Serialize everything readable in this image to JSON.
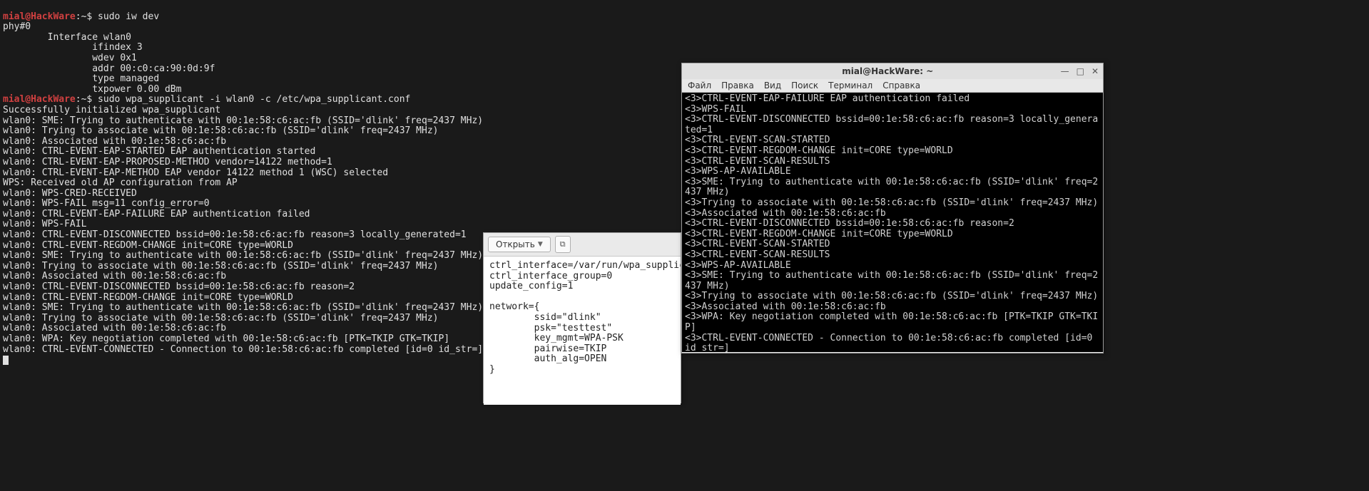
{
  "bg_terminal": {
    "prompt_user": "mial@HackWare",
    "prompt_sep": ":~$",
    "cmd1": " sudo iw dev",
    "out1": "phy#0\n        Interface wlan0\n                ifindex 3\n                wdev 0x1\n                addr 00:c0:ca:90:0d:9f\n                type managed\n                txpower 0.00 dBm",
    "cmd2": " sudo wpa_supplicant -i wlan0 -c /etc/wpa_supplicant.conf",
    "out2": "Successfully initialized wpa_supplicant\nwlan0: SME: Trying to authenticate with 00:1e:58:c6:ac:fb (SSID='dlink' freq=2437 MHz)\nwlan0: Trying to associate with 00:1e:58:c6:ac:fb (SSID='dlink' freq=2437 MHz)\nwlan0: Associated with 00:1e:58:c6:ac:fb\nwlan0: CTRL-EVENT-EAP-STARTED EAP authentication started\nwlan0: CTRL-EVENT-EAP-PROPOSED-METHOD vendor=14122 method=1\nwlan0: CTRL-EVENT-EAP-METHOD EAP vendor 14122 method 1 (WSC) selected\nWPS: Received old AP configuration from AP\nwlan0: WPS-CRED-RECEIVED\nwlan0: WPS-FAIL msg=11 config_error=0\nwlan0: CTRL-EVENT-EAP-FAILURE EAP authentication failed\nwlan0: WPS-FAIL\nwlan0: CTRL-EVENT-DISCONNECTED bssid=00:1e:58:c6:ac:fb reason=3 locally_generated=1\nwlan0: CTRL-EVENT-REGDOM-CHANGE init=CORE type=WORLD\nwlan0: SME: Trying to authenticate with 00:1e:58:c6:ac:fb (SSID='dlink' freq=2437 MHz)\nwlan0: Trying to associate with 00:1e:58:c6:ac:fb (SSID='dlink' freq=2437 MHz)\nwlan0: Associated with 00:1e:58:c6:ac:fb\nwlan0: CTRL-EVENT-DISCONNECTED bssid=00:1e:58:c6:ac:fb reason=2\nwlan0: CTRL-EVENT-REGDOM-CHANGE init=CORE type=WORLD\nwlan0: SME: Trying to authenticate with 00:1e:58:c6:ac:fb (SSID='dlink' freq=2437 MHz)\nwlan0: Trying to associate with 00:1e:58:c6:ac:fb (SSID='dlink' freq=2437 MHz)\nwlan0: Associated with 00:1e:58:c6:ac:fb\nwlan0: WPA: Key negotiation completed with 00:1e:58:c6:ac:fb [PTK=TKIP GTK=TKIP]\nwlan0: CTRL-EVENT-CONNECTED - Connection to 00:1e:58:c6:ac:fb completed [id=0 id_str=]"
  },
  "editor": {
    "open_label": "Открыть",
    "content": "ctrl_interface=/var/run/wpa_supplican\nctrl_interface_group=0\nupdate_config=1\n\nnetwork={\n        ssid=\"dlink\"\n        psk=\"testtest\"\n        key_mgmt=WPA-PSK\n        pairwise=TKIP\n        auth_alg=OPEN\n}"
  },
  "term2": {
    "title": "mial@HackWare: ~",
    "menu": [
      "Файл",
      "Правка",
      "Вид",
      "Поиск",
      "Терминал",
      "Справка"
    ],
    "body": "<3>CTRL-EVENT-EAP-FAILURE EAP authentication failed\n<3>WPS-FAIL\n<3>CTRL-EVENT-DISCONNECTED bssid=00:1e:58:c6:ac:fb reason=3 locally_generated=1\n<3>CTRL-EVENT-SCAN-STARTED\n<3>CTRL-EVENT-REGDOM-CHANGE init=CORE type=WORLD\n<3>CTRL-EVENT-SCAN-RESULTS\n<3>WPS-AP-AVAILABLE\n<3>SME: Trying to authenticate with 00:1e:58:c6:ac:fb (SSID='dlink' freq=2437 MHz)\n<3>Trying to associate with 00:1e:58:c6:ac:fb (SSID='dlink' freq=2437 MHz)\n<3>Associated with 00:1e:58:c6:ac:fb\n<3>CTRL-EVENT-DISCONNECTED bssid=00:1e:58:c6:ac:fb reason=2\n<3>CTRL-EVENT-REGDOM-CHANGE init=CORE type=WORLD\n<3>CTRL-EVENT-SCAN-STARTED\n<3>CTRL-EVENT-SCAN-RESULTS\n<3>WPS-AP-AVAILABLE\n<3>SME: Trying to authenticate with 00:1e:58:c6:ac:fb (SSID='dlink' freq=2437 MHz)\n<3>Trying to associate with 00:1e:58:c6:ac:fb (SSID='dlink' freq=2437 MHz)\n<3>Associated with 00:1e:58:c6:ac:fb\n<3>WPA: Key negotiation completed with 00:1e:58:c6:ac:fb [PTK=TKIP GTK=TKIP]\n<3>CTRL-EVENT-CONNECTED - Connection to 00:1e:58:c6:ac:fb completed [id=0 id_str=]\n> "
  }
}
